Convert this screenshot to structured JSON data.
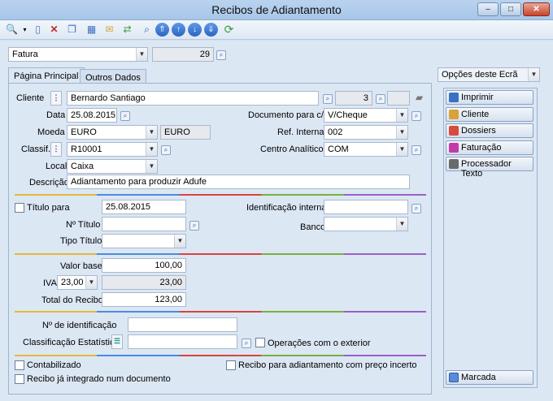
{
  "window": {
    "title": "Recibos de Adiantamento",
    "min": "–",
    "max": "□",
    "close": "✕"
  },
  "header": {
    "doc_type": "Fatura",
    "doc_number": "29"
  },
  "tabs": [
    {
      "label": "Página Principal"
    },
    {
      "label": "Outros Dados"
    }
  ],
  "form": {
    "cliente_label": "Cliente",
    "cliente": "Bernardo Santiago",
    "cliente_num": "3",
    "data_label": "Data",
    "data": "25.08.2015",
    "doc_cc_label": "Documento para c/c",
    "doc_cc": "V/Cheque",
    "moeda_label": "Moeda",
    "moeda": "EURO",
    "moeda_code": "EURO",
    "ref_label": "Ref. Interna",
    "ref": "002",
    "classif_label": "Classif.",
    "classif": "R10001",
    "centro_label": "Centro Analítico",
    "centro": "COM",
    "local_label": "Local",
    "local": "Caixa",
    "descricao_label": "Descrição",
    "descricao": "Adiantamento para produzir Adufe",
    "titulo_para_label": "Título para",
    "titulo_para": "25.08.2015",
    "ident_label": "Identificação interna",
    "num_titulo_label": "Nº Título",
    "banco_label": "Banco",
    "tipo_titulo_label": "Tipo Título",
    "valor_base_label": "Valor base",
    "valor_base": "100,00",
    "iva_label": "IVA",
    "iva_rate": "23,00",
    "iva_value": "23,00",
    "total_label": "Total do Recibo",
    "total": "123,00",
    "num_ident_label": "Nº de identificação",
    "class_est_label": "Classificação Estatística",
    "op_ext_label": "Operações com o exterior",
    "contab_label": "Contabilizado",
    "preco_incerto_label": "Recibo para adiantamento com preço incerto",
    "integrado_label": "Recibo já integrado num documento"
  },
  "side": {
    "options_label": "Opções deste Ecrã",
    "buttons": [
      {
        "label": "Imprimir",
        "color": "#3a6fc4"
      },
      {
        "label": "Cliente",
        "color": "#d9a23a"
      },
      {
        "label": "Dossiers",
        "color": "#d84a3a"
      },
      {
        "label": "Faturação",
        "color": "#c43aa8"
      },
      {
        "label": "Processador Texto",
        "color": "#6a6a6a"
      }
    ],
    "marcada": "Marcada"
  }
}
